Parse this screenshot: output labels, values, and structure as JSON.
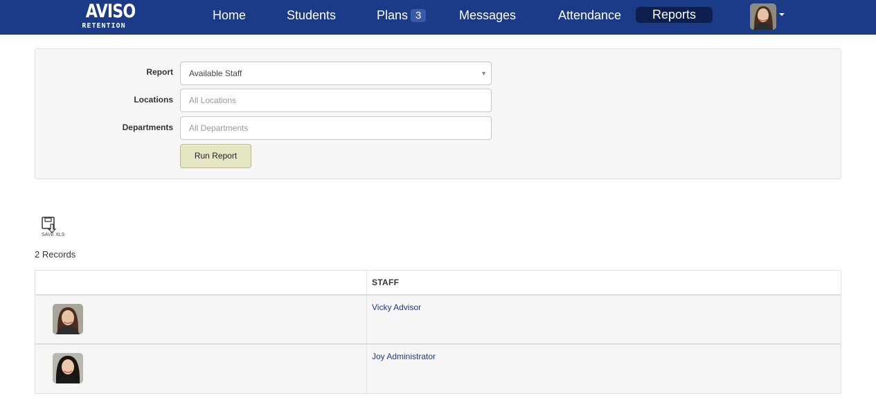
{
  "brand": {
    "name": "AVISO",
    "sub": "RETENTION"
  },
  "nav": {
    "home": "Home",
    "students": "Students",
    "plans": "Plans",
    "plans_badge": "3",
    "messages": "Messages",
    "attendance": "Attendance",
    "reports": "Reports"
  },
  "filters": {
    "report_label": "Report",
    "report_value": "Available Staff",
    "locations_label": "Locations",
    "locations_placeholder": "All Locations",
    "departments_label": "Departments",
    "departments_placeholder": "All Departments",
    "run_button": "Run Report"
  },
  "export": {
    "save_label": "SAVE XLS",
    "icon": "save-xls-icon"
  },
  "records_count": "2 Records",
  "table": {
    "headers": [
      "",
      "STAFF"
    ],
    "rows": [
      {
        "name": "Vicky Advisor"
      },
      {
        "name": "Joy Administrator"
      }
    ]
  },
  "colors": {
    "navbar": "#1b3a87",
    "active_tab": "#0c1f4f",
    "link": "#1b3a87",
    "run_button": "#e6e5c3"
  }
}
